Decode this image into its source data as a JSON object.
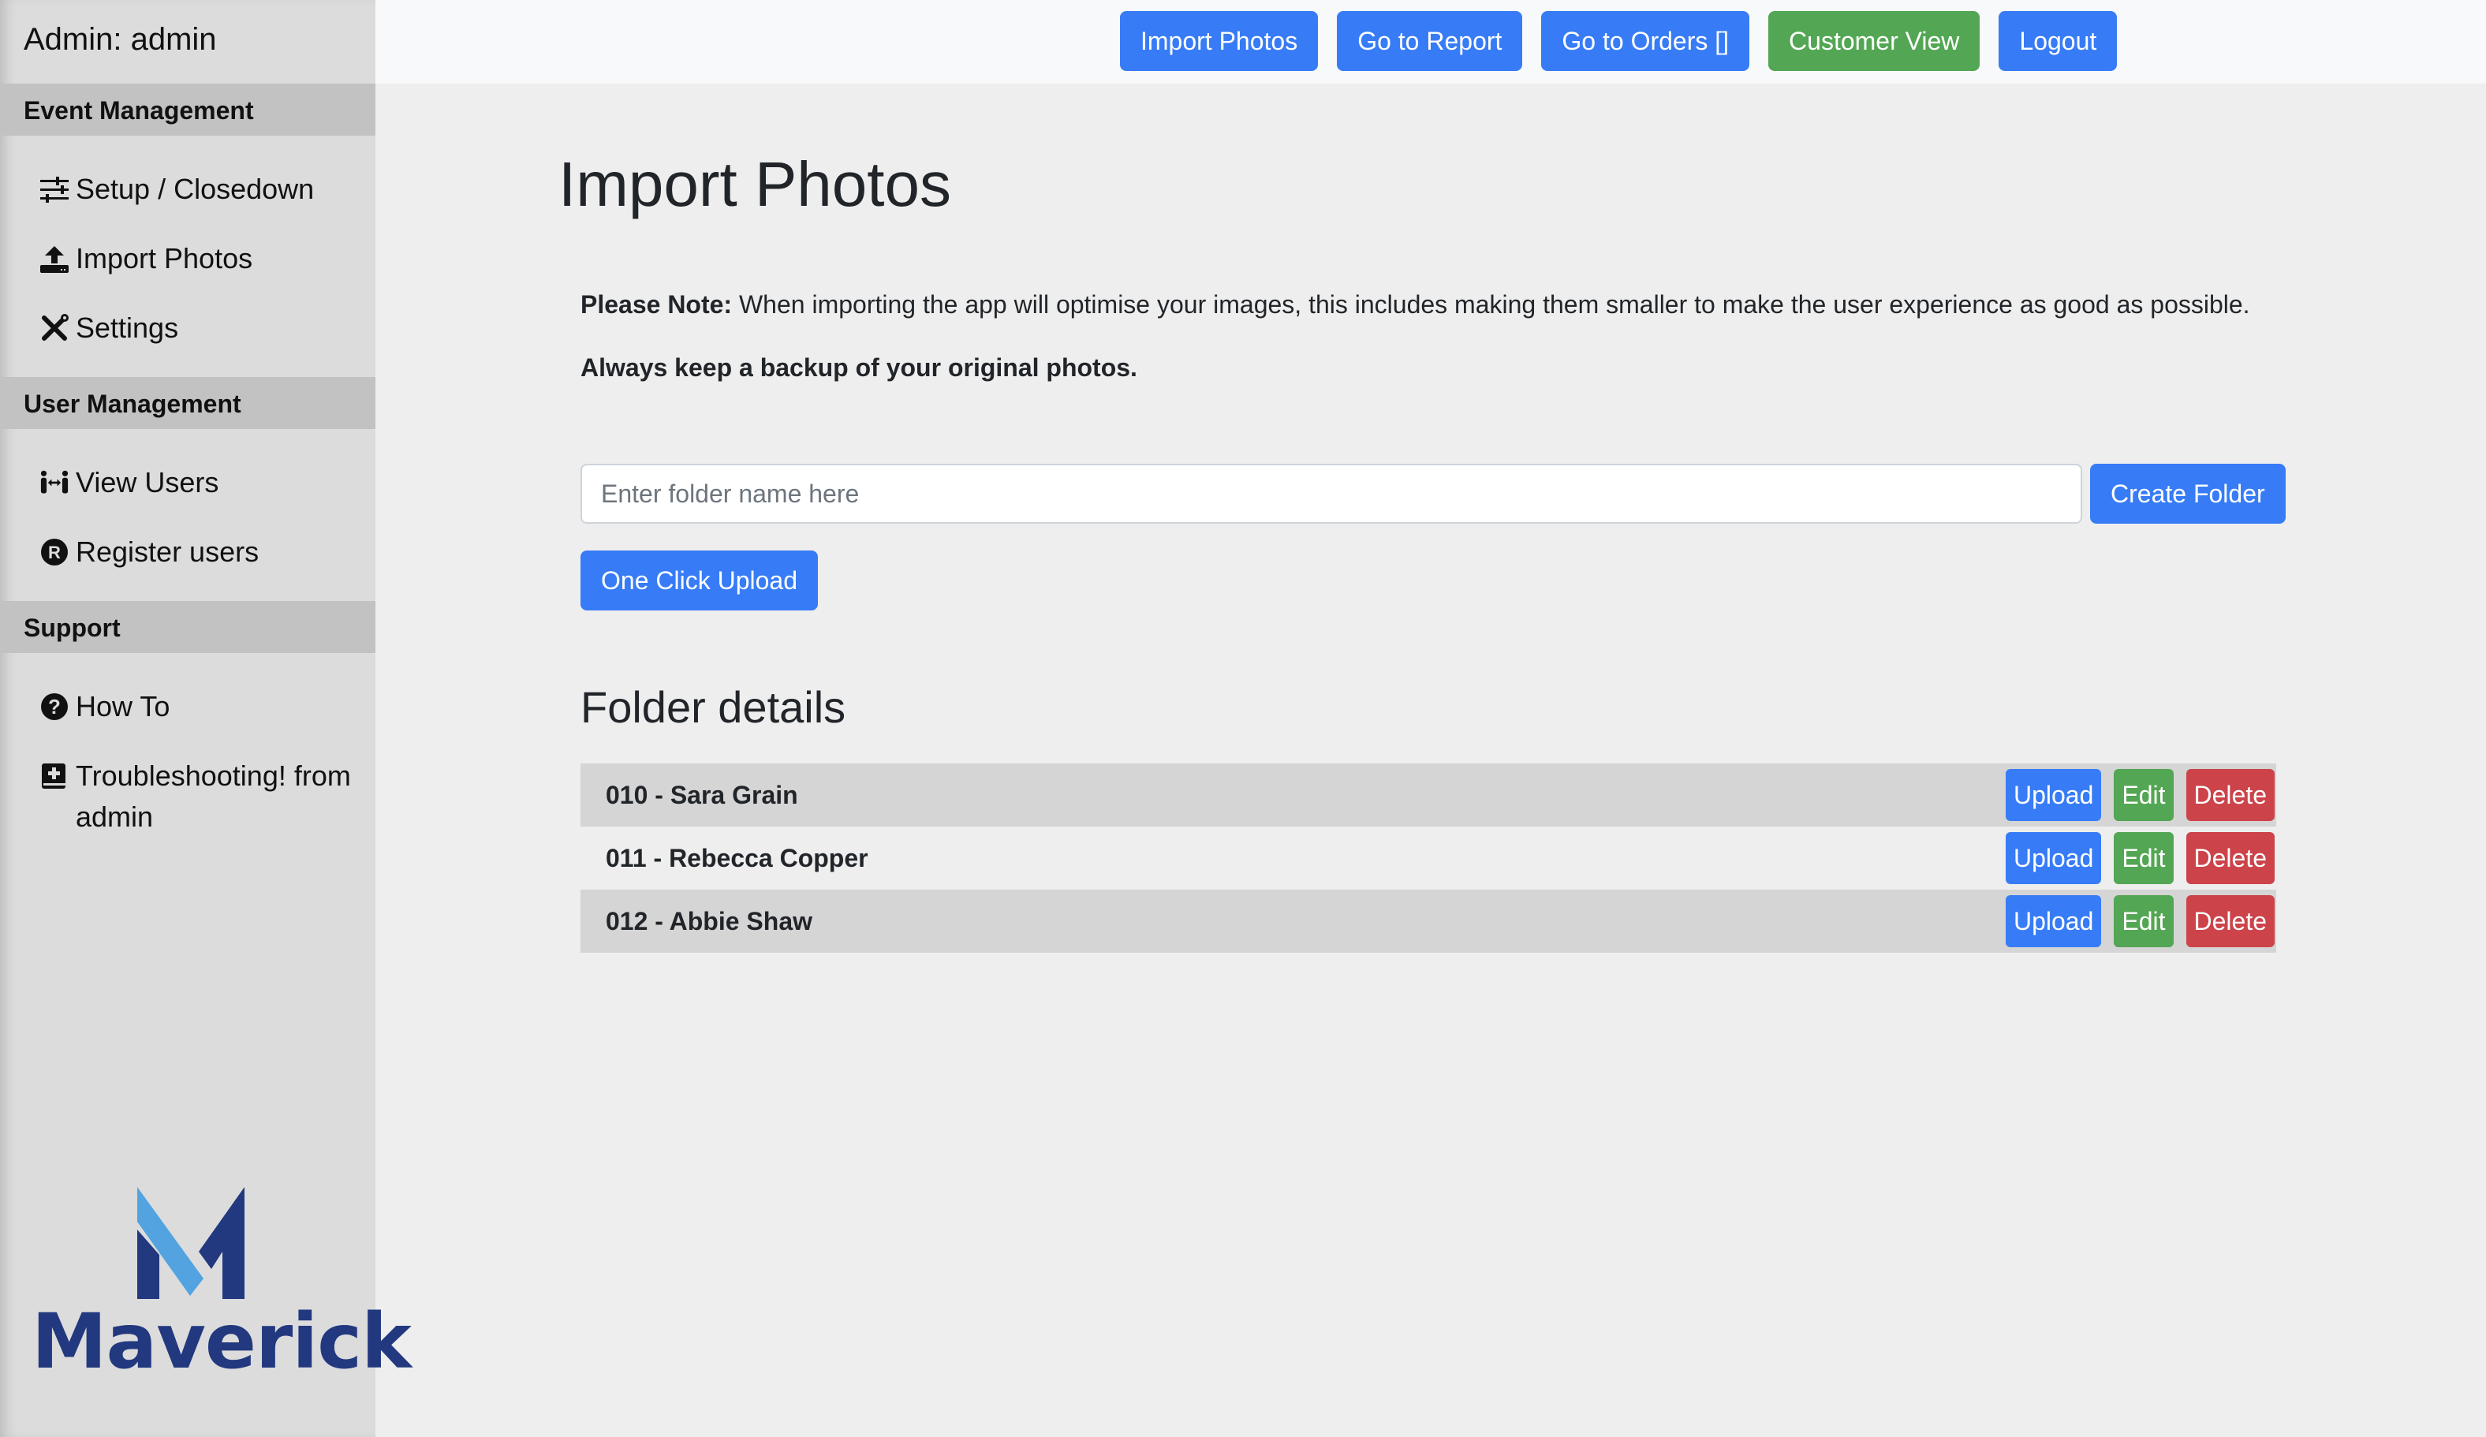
{
  "sidebar": {
    "title": "Admin: admin",
    "sections": [
      {
        "header": "Event Management",
        "items": [
          {
            "label": "Setup / Closedown",
            "icon": "sliders-icon"
          },
          {
            "label": "Import Photos",
            "icon": "upload-icon"
          },
          {
            "label": "Settings",
            "icon": "tools-icon"
          }
        ]
      },
      {
        "header": "User Management",
        "items": [
          {
            "label": "View Users",
            "icon": "users-arrows-icon"
          },
          {
            "label": "Register users",
            "icon": "registered-icon"
          }
        ]
      },
      {
        "header": "Support",
        "items": [
          {
            "label": "How To",
            "icon": "question-circle-icon"
          },
          {
            "label": "Troubleshooting! from admin",
            "icon": "medical-book-icon"
          }
        ]
      }
    ],
    "logo_text": "Maverick"
  },
  "topbar": {
    "buttons": [
      {
        "label": "Import Photos",
        "color": "#377cf6"
      },
      {
        "label": "Go to Report",
        "color": "#377cf6"
      },
      {
        "label": "Go to Orders []",
        "color": "#377cf6"
      },
      {
        "label": "Customer View",
        "color": "#53a653"
      },
      {
        "label": "Logout",
        "color": "#377cf6"
      }
    ]
  },
  "main": {
    "title": "Import Photos",
    "note_bold": "Please Note:",
    "note_text": " When importing the app will optimise your images, this includes making them smaller to make the user experience as good as possible.",
    "backup_text": "Always keep a backup of your original photos.",
    "folder_input": {
      "placeholder": "Enter folder name here",
      "value": ""
    },
    "create_folder_label": "Create Folder",
    "one_click_upload_label": "One Click Upload",
    "folder_heading": "Folder details",
    "folders": [
      {
        "name": "010 - Sara Grain"
      },
      {
        "name": "011 - Rebecca Copper"
      },
      {
        "name": "012 - Abbie Shaw"
      }
    ],
    "row_actions": {
      "upload": "Upload",
      "edit": "Edit",
      "delete": "Delete"
    }
  },
  "colors": {
    "primary": "#377cf6",
    "success": "#53a653",
    "danger": "#cc434a",
    "logo_dark": "#22387f",
    "logo_light": "#52a3e0"
  }
}
